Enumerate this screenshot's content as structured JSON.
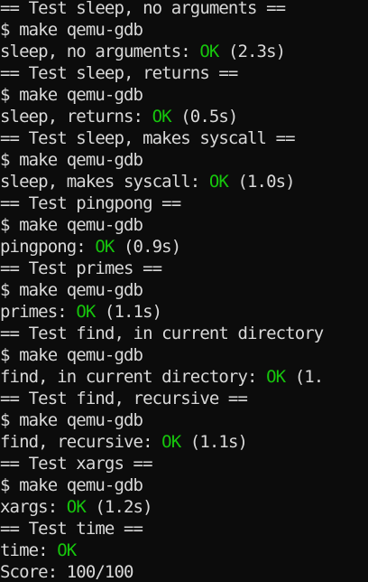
{
  "window": {
    "background": "#0c0c0c",
    "text_color": "#d9d9d9",
    "ok_color": "#16c60c"
  },
  "lines": [
    {
      "before": "== Test sleep, no arguments ==",
      "ok": "",
      "after": ""
    },
    {
      "before": "$ make qemu-gdb",
      "ok": "",
      "after": ""
    },
    {
      "before": "sleep, no arguments: ",
      "ok": "OK",
      "after": " (2.3s)"
    },
    {
      "before": "== Test sleep, returns ==",
      "ok": "",
      "after": ""
    },
    {
      "before": "$ make qemu-gdb",
      "ok": "",
      "after": ""
    },
    {
      "before": "sleep, returns: ",
      "ok": "OK",
      "after": " (0.5s)"
    },
    {
      "before": "== Test sleep, makes syscall ==",
      "ok": "",
      "after": ""
    },
    {
      "before": "$ make qemu-gdb",
      "ok": "",
      "after": ""
    },
    {
      "before": "sleep, makes syscall: ",
      "ok": "OK",
      "after": " (1.0s)"
    },
    {
      "before": "== Test pingpong ==",
      "ok": "",
      "after": ""
    },
    {
      "before": "$ make qemu-gdb",
      "ok": "",
      "after": ""
    },
    {
      "before": "pingpong: ",
      "ok": "OK",
      "after": " (0.9s)"
    },
    {
      "before": "== Test primes ==",
      "ok": "",
      "after": ""
    },
    {
      "before": "$ make qemu-gdb",
      "ok": "",
      "after": ""
    },
    {
      "before": "primes: ",
      "ok": "OK",
      "after": " (1.1s)"
    },
    {
      "before": "== Test find, in current directory",
      "ok": "",
      "after": ""
    },
    {
      "before": "$ make qemu-gdb",
      "ok": "",
      "after": ""
    },
    {
      "before": "find, in current directory: ",
      "ok": "OK",
      "after": " (1."
    },
    {
      "before": "== Test find, recursive ==",
      "ok": "",
      "after": ""
    },
    {
      "before": "$ make qemu-gdb",
      "ok": "",
      "after": ""
    },
    {
      "before": "find, recursive: ",
      "ok": "OK",
      "after": " (1.1s)"
    },
    {
      "before": "== Test xargs ==",
      "ok": "",
      "after": ""
    },
    {
      "before": "$ make qemu-gdb",
      "ok": "",
      "after": ""
    },
    {
      "before": "xargs: ",
      "ok": "OK",
      "after": " (1.2s)"
    },
    {
      "before": "== Test time ==",
      "ok": "",
      "after": ""
    },
    {
      "before": "time: ",
      "ok": "OK",
      "after": ""
    },
    {
      "before": "Score: 100/100",
      "ok": "",
      "after": ""
    }
  ]
}
